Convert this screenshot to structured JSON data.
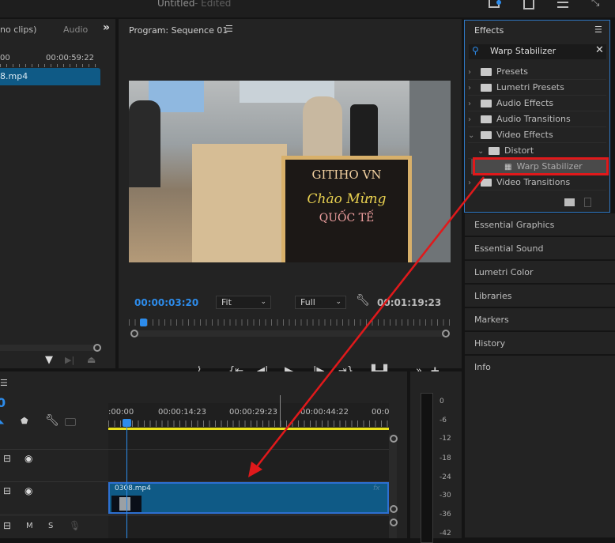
{
  "titlebar": {
    "title": "Untitled",
    "suffix": " - Edited"
  },
  "source_panel": {
    "tab_clips": "no clips)",
    "tab_audio": "Audio",
    "more": "»",
    "ruler_start": "00",
    "ruler_end": "00:00:59:22",
    "clip_name": "8.mp4"
  },
  "program": {
    "title": "Program: Sequence 01",
    "current_time": "00:00:03:20",
    "fit": "Fit",
    "quality": "Full",
    "duration": "00:01:19:23",
    "sign_text": "GITIHO VN",
    "sign_text2": "Chào Mừng",
    "sign_text3": "QUỐC TẾ"
  },
  "effects": {
    "title": "Effects",
    "search_value": "Warp Stabilizer",
    "items": [
      {
        "label": "Presets",
        "state": "collapsed"
      },
      {
        "label": "Lumetri Presets",
        "state": "collapsed"
      },
      {
        "label": "Audio Effects",
        "state": "collapsed"
      },
      {
        "label": "Audio Transitions",
        "state": "collapsed"
      },
      {
        "label": "Video Effects",
        "state": "expanded"
      },
      {
        "label": "Distort",
        "state": "expanded"
      },
      {
        "label": "Warp Stabilizer",
        "state": "selected"
      },
      {
        "label": "Video Transitions",
        "state": "collapsed"
      }
    ]
  },
  "right_panels": [
    "Essential Graphics",
    "Essential Sound",
    "Lumetri Color",
    "Libraries",
    "Markers",
    "History",
    "Info"
  ],
  "timeline": {
    "timecode_partial": "0",
    "ruler": [
      ":00:00",
      "00:00:14:23",
      "00:00:29:23",
      "00:00:44:22",
      "00:0"
    ],
    "clip_name": "0308.mp4",
    "fx": "fx",
    "track_m": "M",
    "track_s": "S"
  },
  "meter": {
    "labels": [
      "0",
      "-6",
      "-12",
      "-18",
      "-24",
      "-30",
      "-36",
      "-42"
    ]
  },
  "colors": {
    "accent": "#2d8ceb",
    "clip": "#0f5a86",
    "highlight": "#e0191b",
    "work_area": "#e8e01c"
  }
}
